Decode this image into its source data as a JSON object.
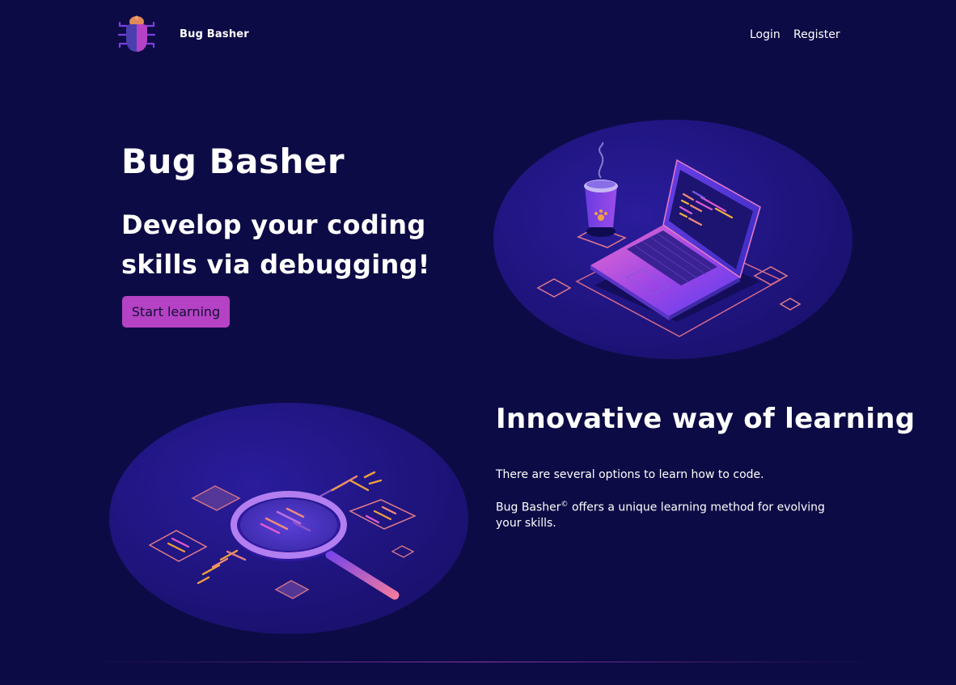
{
  "header": {
    "brand": "Bug Basher",
    "nav": {
      "login": "Login",
      "register": "Register"
    }
  },
  "hero": {
    "title": "Bug Basher",
    "subtitle": "Develop your coding skills via debugging!",
    "cta_label": "Start learning"
  },
  "feature": {
    "title": "Innovative way of learning",
    "paragraph1": "There are several options to learn how to code.",
    "paragraph2_brand": "Bug Basher",
    "paragraph2_mark": "©",
    "paragraph2_rest": " offers a unique learning method for evolving your skills."
  },
  "icons": {
    "logo": "bug-icon",
    "hero_illustration": "laptop-code-illustration",
    "feature_illustration": "magnifier-code-illustration"
  },
  "colors": {
    "background": "#0d0b45",
    "accent": "#b542c5",
    "text": "#ffffff"
  }
}
